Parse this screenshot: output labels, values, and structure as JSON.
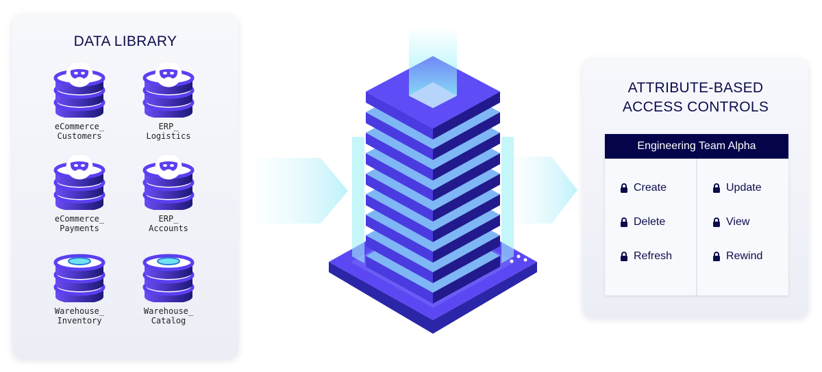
{
  "library": {
    "title": "DATA LIBRARY",
    "datasets": [
      {
        "label": "eCommerce_\nCustomers",
        "icon": "mask-icon"
      },
      {
        "label": "ERP_\nLogistics",
        "icon": "mask-icon"
      },
      {
        "label": "eCommerce_\nPayments",
        "icon": "mask-icon"
      },
      {
        "label": "ERP_\nAccounts",
        "icon": "mask-icon"
      },
      {
        "label": "Warehouse_\nInventory",
        "icon": "disk-icon"
      },
      {
        "label": "Warehouse_\nCatalog",
        "icon": "disk-icon"
      }
    ]
  },
  "abac": {
    "title_line1": "ATTRIBUTE-BASED",
    "title_line2": "ACCESS CONTROLS",
    "team": "Engineering Team Alpha",
    "permissions_left": [
      "Create",
      "Delete",
      "Refresh"
    ],
    "permissions_right": [
      "Update",
      "View",
      "Rewind"
    ]
  },
  "colors": {
    "navy": "#03044a",
    "purple": "#5b3ff0",
    "cyan": "#6fe3f0"
  }
}
